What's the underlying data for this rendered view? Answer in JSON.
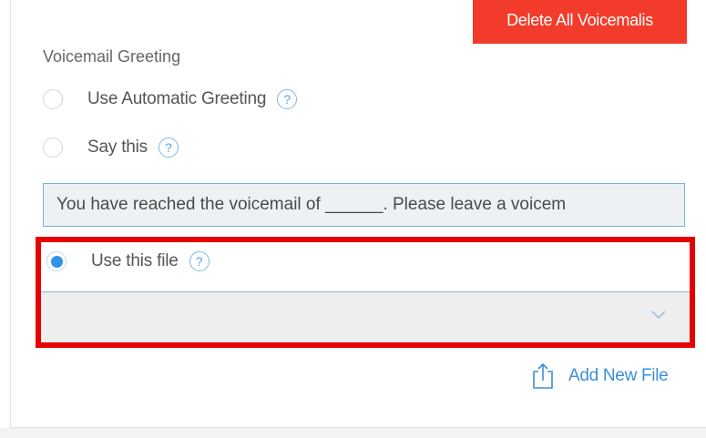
{
  "actions": {
    "delete_all_label": "Delete All Voicemalis"
  },
  "greeting": {
    "section_title": "Voicemail Greeting",
    "options": [
      {
        "label": "Use Automatic Greeting",
        "selected": false
      },
      {
        "label": "Say this",
        "selected": false
      },
      {
        "label": "Use this file",
        "selected": true
      }
    ],
    "help_glyph": "?",
    "say_this_text": "You have reached the voicemail of ______. Please leave a voicem",
    "file_select_value": "",
    "add_file_label": "Add New File"
  },
  "icons": {
    "help": "question-circle-icon",
    "chevron": "chevron-down-icon",
    "upload": "upload-icon"
  },
  "colors": {
    "danger": "#f23b2a",
    "accent": "#2d95e8",
    "link": "#3d8fd6",
    "highlight": "#e60000"
  }
}
